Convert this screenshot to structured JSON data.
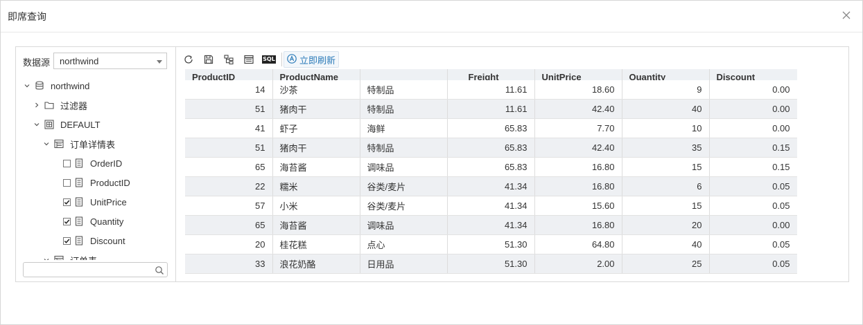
{
  "dialog": {
    "title": "即席查询"
  },
  "datasource": {
    "label": "数据源",
    "value": "northwind"
  },
  "tree": {
    "nodes": [
      {
        "label": "northwind"
      },
      {
        "label": "过滤器"
      },
      {
        "label": "DEFAULT"
      },
      {
        "label": "订单详情表"
      },
      {
        "label": "OrderID",
        "checked": false
      },
      {
        "label": "ProductID",
        "checked": false
      },
      {
        "label": "UnitPrice",
        "checked": true
      },
      {
        "label": "Quantity",
        "checked": true
      },
      {
        "label": "Discount",
        "checked": true
      },
      {
        "label": "订单表"
      }
    ]
  },
  "search": {
    "placeholder": ""
  },
  "toolbar": {
    "sql_label": "SQL",
    "refresh_label": "立即刷新"
  },
  "table": {
    "headers": [
      "ProductID",
      "ProductName",
      "",
      "Freight",
      "UnitPrice",
      "Quantity",
      "Discount"
    ],
    "rows": [
      [
        "14",
        "沙茶",
        "特制品",
        "11.61",
        "18.60",
        "9",
        "0.00"
      ],
      [
        "51",
        "猪肉干",
        "特制品",
        "11.61",
        "42.40",
        "40",
        "0.00"
      ],
      [
        "41",
        "虾子",
        "海鲜",
        "65.83",
        "7.70",
        "10",
        "0.00"
      ],
      [
        "51",
        "猪肉干",
        "特制品",
        "65.83",
        "42.40",
        "35",
        "0.15"
      ],
      [
        "65",
        "海苔酱",
        "调味品",
        "65.83",
        "16.80",
        "15",
        "0.15"
      ],
      [
        "22",
        "糯米",
        "谷类/麦片",
        "41.34",
        "16.80",
        "6",
        "0.05"
      ],
      [
        "57",
        "小米",
        "谷类/麦片",
        "41.34",
        "15.60",
        "15",
        "0.05"
      ],
      [
        "65",
        "海苔酱",
        "调味品",
        "41.34",
        "16.80",
        "20",
        "0.00"
      ],
      [
        "20",
        "桂花糕",
        "点心",
        "51.30",
        "64.80",
        "40",
        "0.05"
      ],
      [
        "33",
        "浪花奶酪",
        "日用品",
        "51.30",
        "2.00",
        "25",
        "0.05"
      ]
    ]
  },
  "colors": {
    "accent": "#2a7ab8",
    "row_alt": "#eef0f3",
    "header_bg": "#eef1f4"
  }
}
